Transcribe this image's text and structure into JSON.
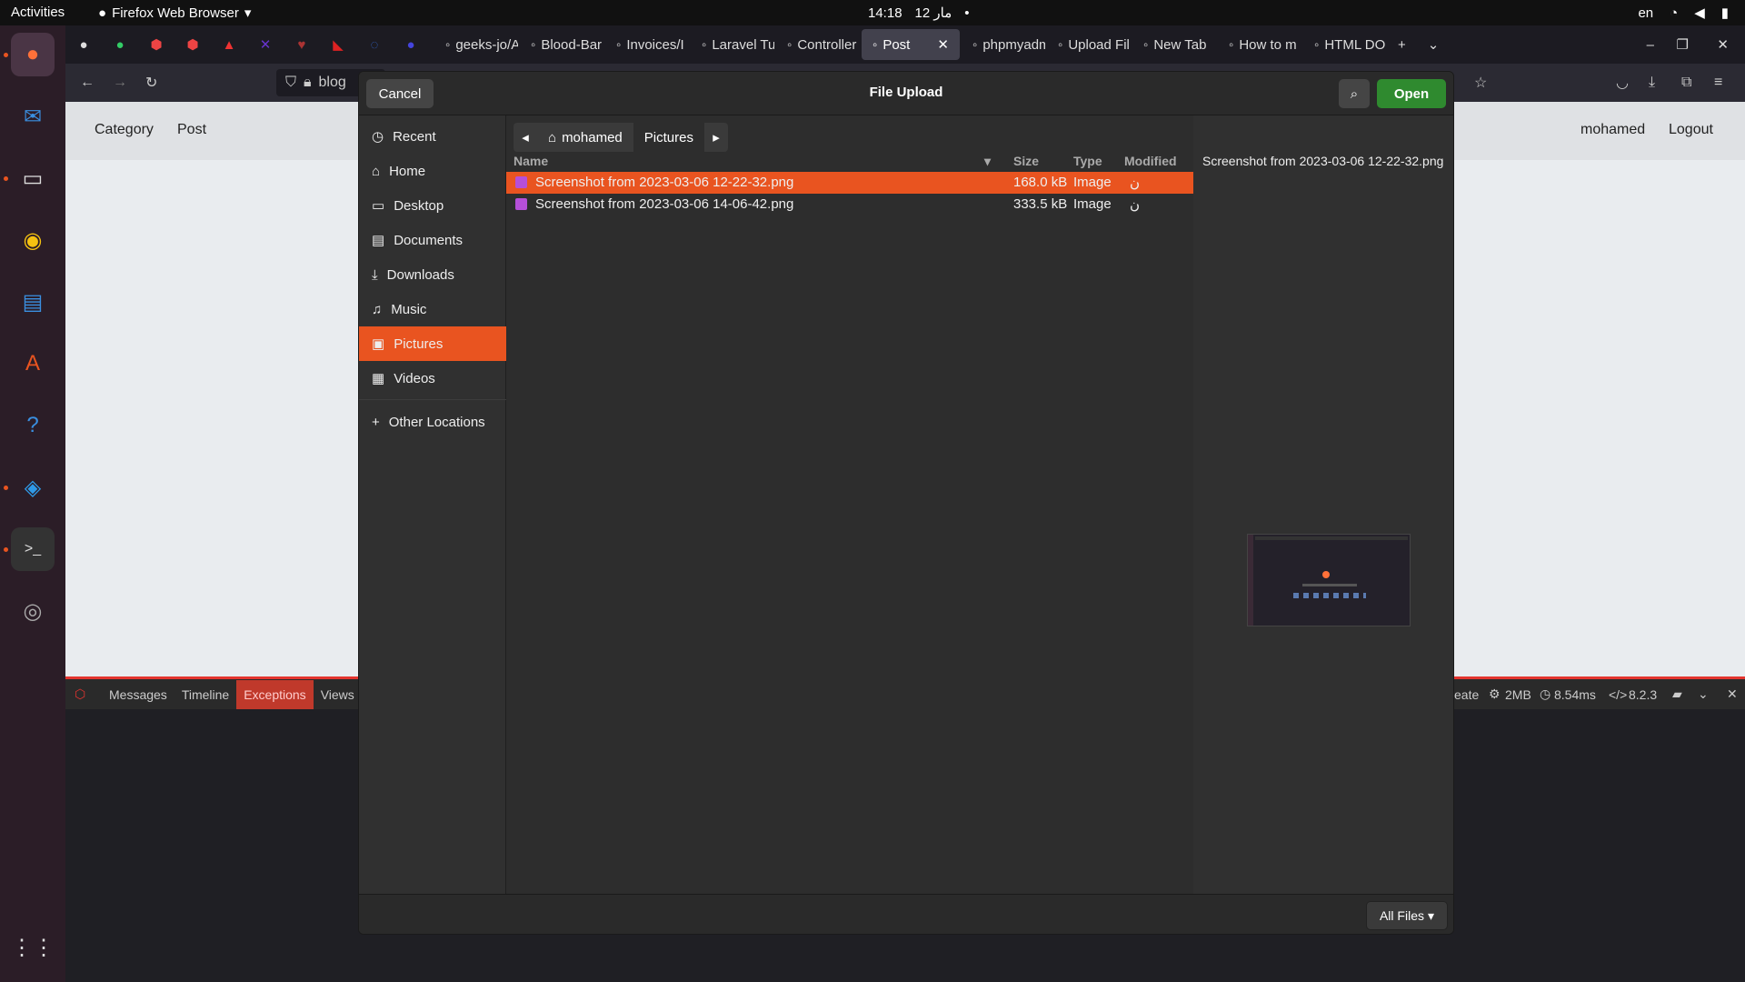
{
  "topbar": {
    "activities": "Activities",
    "app_name": "Firefox Web Browser",
    "time": "14:18",
    "date": "12 مار",
    "lang": "en"
  },
  "tabs": [
    {
      "label": "geeks-jo/A"
    },
    {
      "label": "Blood-Bar"
    },
    {
      "label": "Invoices/I"
    },
    {
      "label": "Laravel Tu"
    },
    {
      "label": "Controller"
    },
    {
      "label": "Post",
      "active": true
    },
    {
      "label": "phpmyadmin"
    },
    {
      "label": "Upload Fil"
    },
    {
      "label": "New Tab"
    },
    {
      "label": "How to m"
    },
    {
      "label": "HTML DO"
    }
  ],
  "navbar": {
    "url_fragment": "blog"
  },
  "page": {
    "nav": [
      "Category",
      "Post"
    ],
    "user": "mohamed",
    "logout": "Logout"
  },
  "debugbar": {
    "tabs": [
      "Messages",
      "Timeline",
      "Exceptions",
      "Views"
    ],
    "partial": "eate",
    "memory": "2MB",
    "time": "8.54ms",
    "version": "8.2.3"
  },
  "dialog": {
    "title": "File Upload",
    "cancel": "Cancel",
    "open": "Open",
    "sidebar": [
      {
        "label": "Recent",
        "icon": "clock-icon"
      },
      {
        "label": "Home",
        "icon": "home-icon"
      },
      {
        "label": "Desktop",
        "icon": "desktop-icon"
      },
      {
        "label": "Documents",
        "icon": "document-icon"
      },
      {
        "label": "Downloads",
        "icon": "download-icon"
      },
      {
        "label": "Music",
        "icon": "music-icon"
      },
      {
        "label": "Pictures",
        "icon": "picture-icon",
        "selected": true
      },
      {
        "label": "Videos",
        "icon": "video-icon"
      },
      {
        "label": "Other Locations",
        "icon": "plus-icon"
      }
    ],
    "path": [
      "mohamed",
      "Pictures"
    ],
    "columns": {
      "name": "Name",
      "size": "Size",
      "type": "Type",
      "modified": "Modified"
    },
    "files": [
      {
        "name": "Screenshot from 2023-03-06 12-22-32.png",
        "size": "168.0 kB",
        "type": "Image",
        "modified": "ن"
      },
      {
        "name": "Screenshot from 2023-03-06 14-06-42.png",
        "size": "333.5 kB",
        "type": "Image",
        "modified": "ن"
      }
    ],
    "preview_name": "Screenshot from 2023-03-06 12-22-32.png",
    "filter": "All Files"
  },
  "colors": {
    "accent": "#e95420",
    "open_button": "#2f8a2f",
    "dock": "#2b1d27"
  }
}
